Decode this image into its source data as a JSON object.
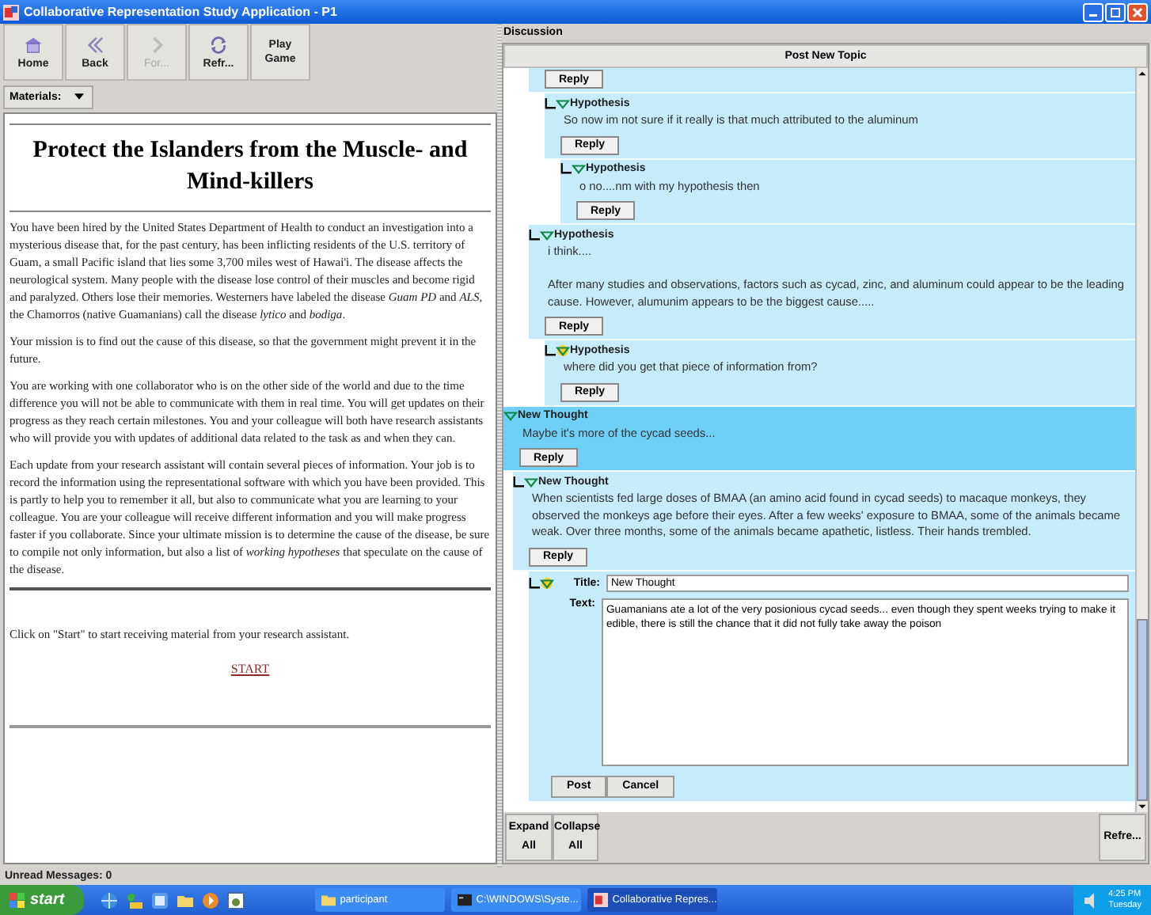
{
  "window": {
    "title": "Collaborative Representation Study Application - P1"
  },
  "toolbar": [
    {
      "kind": "home",
      "label": "Home",
      "disabled": false
    },
    {
      "kind": "back",
      "label": "Back",
      "disabled": false
    },
    {
      "kind": "forward",
      "label": "For...",
      "disabled": true
    },
    {
      "kind": "refresh",
      "label": "Refr...",
      "disabled": false
    },
    {
      "kind": "text",
      "label": "Play Game",
      "disabled": false
    }
  ],
  "materials": {
    "label": "Materials:"
  },
  "document": {
    "heading": "Protect the Islanders from the Muscle- and Mind-killers",
    "paragraphs": [
      "You have been hired by the United States Department of Health to conduct an investigation into a mysterious disease that, for the past century, has been inflicting residents of the U.S. territory of Guam, a small Pacific island that lies some 3,700 miles west of Hawai'i. The disease affects the neurological system. Many people with the disease lose control of their muscles and become rigid and paralyzed. Others lose their memories. Westerners have labeled the disease *Guam PD* and *ALS*, the Chamorros (native Guamanians) call the disease *lytico* and *bodiga*.",
      "Your mission is to find out the cause of this disease, so that the government might prevent it in the future.",
      "You are working with one collaborator who is on the other side of the world and due to the time difference you will not be able to communicate with them in real time. You will get updates on their progress as they reach certain milestones. You and your colleague will both have research assistants who will provide you with updates of additional data related to the task as and when they can.",
      "Each update from your research assistant will contain several pieces of information. Your job is to record the information using the representational software with which you have been provided. This is partly to help you to remember it all, but also to communicate what you are learning to your colleague. You are your colleague will receive different information and you will make progress faster if you collaborate. Since your ultimate mission is to determine the cause of the disease, be sure to compile not only information, but also a list of *working hypotheses* that speculate on the cause of the disease."
    ],
    "prompt": "Click on \"Start\" to start receiving material from your research assistant.",
    "start_link": "START"
  },
  "discussion": {
    "label": "Discussion",
    "post_new_topic": "Post New Topic",
    "thread": [
      {
        "kind": "continued",
        "children": [
          {
            "kind": "continued",
            "children": [
              {
                "kind": "continued",
                "reply": "Reply",
                "children": [
                  {
                    "kind": "post",
                    "title": "Hypothesis",
                    "text": "So now im not sure if it really is that much attributed to the aluminum",
                    "reply": "Reply",
                    "selected": false,
                    "hovered": false,
                    "children": [
                      {
                        "kind": "post",
                        "title": "Hypothesis",
                        "text": "o no....nm with my hypothesis then",
                        "reply": "Reply",
                        "selected": false,
                        "hovered": false
                      }
                    ]
                  }
                ]
              },
              {
                "kind": "post",
                "title": "Hypothesis",
                "text": "i think....\n\nAfter many studies and observations, factors such as cycad, zinc, and aluminum could appear to be the leading cause.  However, alumunim appears to be the biggest cause.....",
                "reply": "Reply",
                "selected": false,
                "hovered": false,
                "children": [
                  {
                    "kind": "post",
                    "title": "Hypothesis",
                    "text": "where did you get that piece of information from?\n ",
                    "reply": "Reply",
                    "selected": false,
                    "hovered": true
                  }
                ]
              }
            ]
          }
        ]
      },
      {
        "kind": "post",
        "title": "New Thought",
        "text": "Maybe it's more of the cycad seeds...",
        "reply": "Reply",
        "selected": true,
        "hovered": false,
        "children": [
          {
            "kind": "post",
            "title": "New Thought",
            "text": "When scientists fed large doses of BMAA (an amino acid found in cycad seeds) to macaque monkeys, they observed the monkeys age before their eyes. After a few weeks' exposure to BMAA, some of the animals became weak. Over three months, some of the animals became apathetic, listless. Their hands trembled.",
            "reply": "Reply",
            "selected": false,
            "hovered": false,
            "children": [
              {
                "kind": "compose",
                "hovered": true,
                "title_label": "Title:",
                "title_value": "New Thought",
                "text_label": "Text:",
                "text_value": "Guamanians ate a lot of the very posionious cycad seeds... even though they spent weeks trying to make it edible, there is still the chance that it did not fully take away the poison",
                "post": "Post",
                "cancel": "Cancel"
              }
            ]
          }
        ]
      }
    ],
    "expand_all": "Expand All",
    "collapse_all": "Collapse All",
    "refresh": "Refre..."
  },
  "status": "Unread Messages: 0",
  "taskbar": {
    "start": "start",
    "tasks": [
      {
        "kind": "folder",
        "label": "participant",
        "selected": false
      },
      {
        "kind": "console",
        "label": "C:\\WINDOWS\\Syste...",
        "selected": false
      },
      {
        "kind": "app",
        "label": "Collaborative Repres...",
        "selected": true
      }
    ],
    "time": "4:25 PM",
    "day": "Tuesday"
  }
}
